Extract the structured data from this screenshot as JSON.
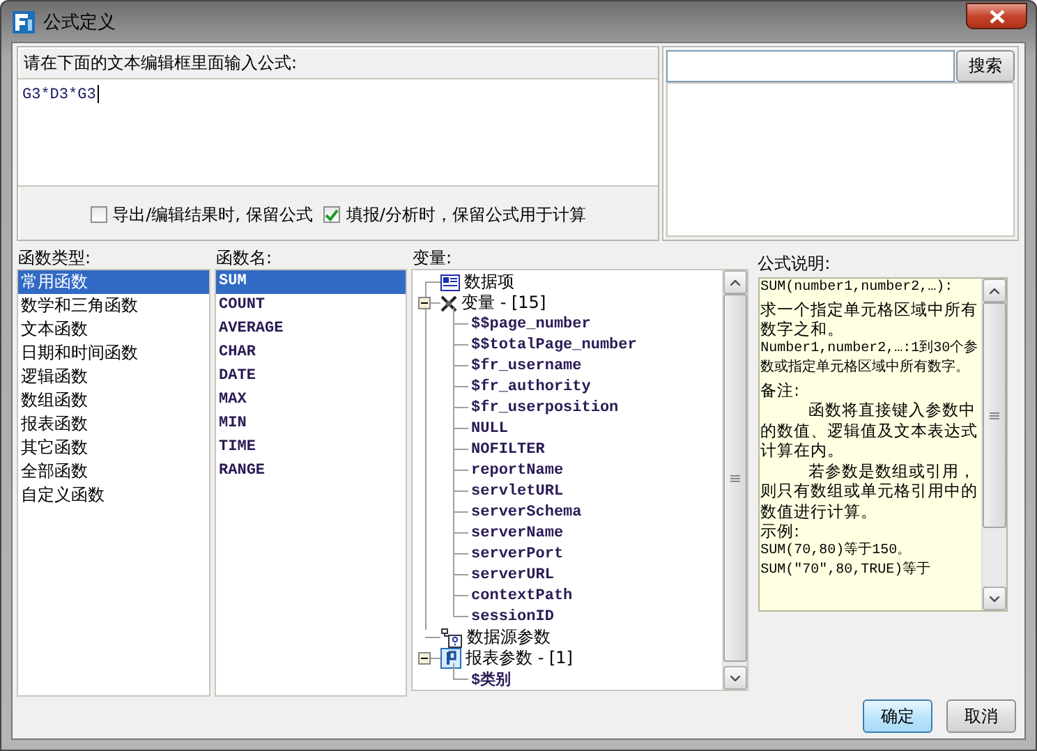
{
  "window": {
    "title": "公式定义"
  },
  "editor": {
    "prompt": "请在下面的文本编辑框里面输入公式:",
    "value": "G3*D3*G3"
  },
  "options": [
    {
      "label": "导出/编辑结果时, 保留公式",
      "checked": false
    },
    {
      "label": "填报/分析时，保留公式用于计算",
      "checked": true
    }
  ],
  "search": {
    "button": "搜索"
  },
  "function_types": {
    "label": "函数类型:",
    "items": [
      {
        "label": "常用函数",
        "selected": true
      },
      {
        "label": "数学和三角函数",
        "selected": false
      },
      {
        "label": "文本函数",
        "selected": false
      },
      {
        "label": "日期和时间函数",
        "selected": false
      },
      {
        "label": "逻辑函数",
        "selected": false
      },
      {
        "label": "数组函数",
        "selected": false
      },
      {
        "label": "报表函数",
        "selected": false
      },
      {
        "label": "其它函数",
        "selected": false
      },
      {
        "label": "全部函数",
        "selected": false
      },
      {
        "label": "自定义函数",
        "selected": false
      }
    ]
  },
  "function_names": {
    "label": "函数名:",
    "items": [
      {
        "label": "SUM",
        "selected": true
      },
      {
        "label": "COUNT",
        "selected": false
      },
      {
        "label": "AVERAGE",
        "selected": false
      },
      {
        "label": "CHAR",
        "selected": false
      },
      {
        "label": "DATE",
        "selected": false
      },
      {
        "label": "MAX",
        "selected": false
      },
      {
        "label": "MIN",
        "selected": false
      },
      {
        "label": "TIME",
        "selected": false
      },
      {
        "label": "RANGE",
        "selected": false
      }
    ]
  },
  "variables": {
    "label": "变量:",
    "tree": [
      {
        "label": "数据项",
        "kind": "data"
      },
      {
        "label": "变量 - [15]",
        "kind": "variables",
        "expanded": true,
        "children": [
          {
            "label": "$$page_number"
          },
          {
            "label": "$$totalPage_number"
          },
          {
            "label": "$fr_username"
          },
          {
            "label": "$fr_authority"
          },
          {
            "label": "$fr_userposition"
          },
          {
            "label": "NULL"
          },
          {
            "label": "NOFILTER"
          },
          {
            "label": "reportName"
          },
          {
            "label": "servletURL"
          },
          {
            "label": "serverSchema"
          },
          {
            "label": "serverName"
          },
          {
            "label": "serverPort"
          },
          {
            "label": "serverURL"
          },
          {
            "label": "contextPath"
          },
          {
            "label": "sessionID"
          }
        ]
      },
      {
        "label": "数据源参数",
        "kind": "datasource"
      },
      {
        "label": "报表参数 - [1]",
        "kind": "parameter",
        "expanded": true,
        "children": [
          {
            "label": "$类别"
          }
        ]
      }
    ]
  },
  "description": {
    "label": "公式说明:",
    "paragraphs": [
      {
        "kind": "code",
        "text": "SUM(number1,number2,…):"
      },
      {
        "kind": "text",
        "text": "求一个指定单元格区域中所有数字之和。"
      },
      {
        "kind": "code",
        "text": "Number1,number2,…:1到30个参数或指定单元格区域中所有数字。"
      },
      {
        "kind": "text",
        "text": "备注:"
      },
      {
        "kind": "indent",
        "text": "函数将直接键入参数中的数值、逻辑值及文本表达式计算在内。"
      },
      {
        "kind": "indent",
        "text": "若参数是数组或引用，则只有数组或单元格引用中的数值进行计算。"
      },
      {
        "kind": "text",
        "text": "示例:"
      },
      {
        "kind": "code",
        "text": "SUM(70,80)等于150。"
      },
      {
        "kind": "code",
        "text": "SUM(\"70\",80,TRUE)等于"
      }
    ]
  },
  "buttons": [
    {
      "label": "确定",
      "kind": "primary"
    },
    {
      "label": "取消",
      "kind": "default"
    }
  ]
}
